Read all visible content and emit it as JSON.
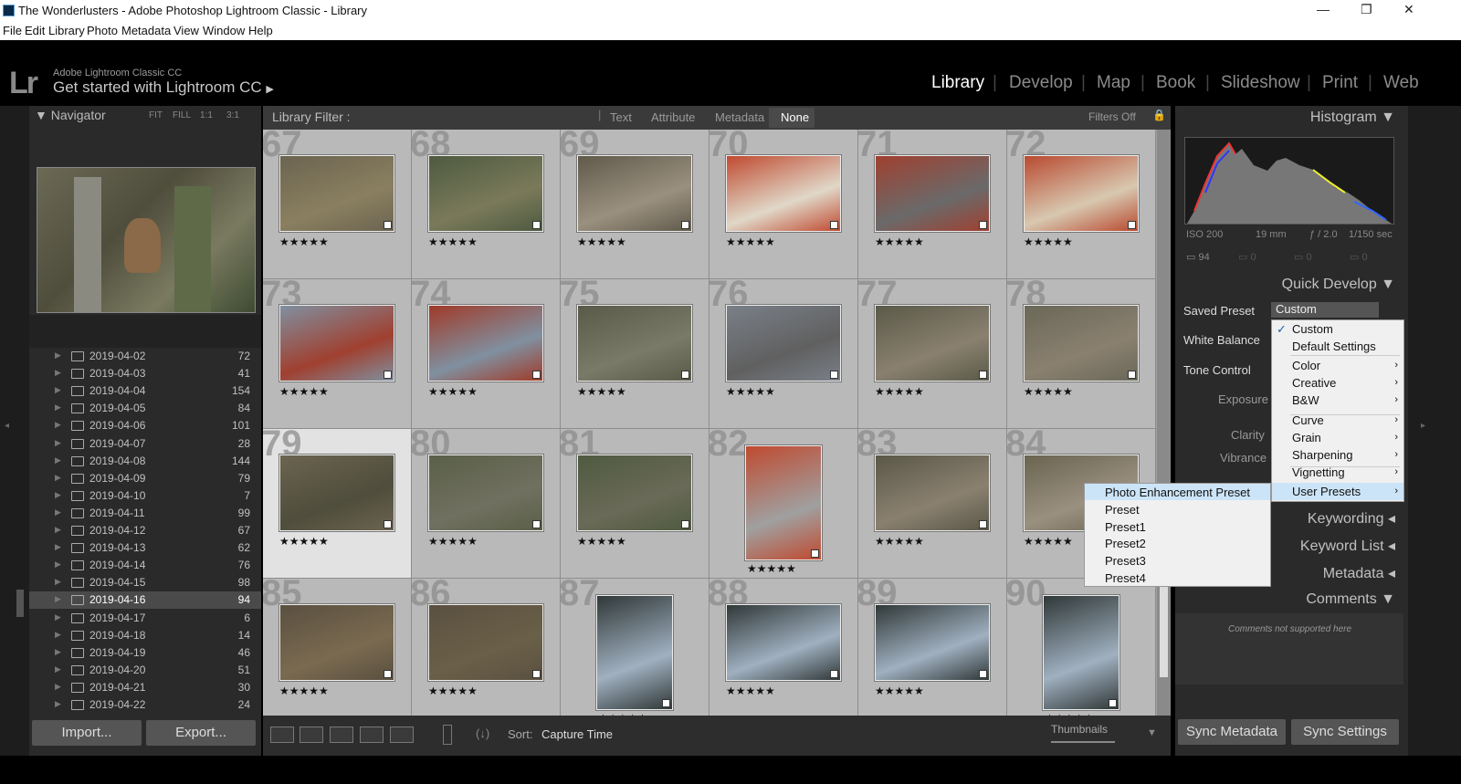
{
  "window": {
    "title": "The Wonderlusters - Adobe Photoshop Lightroom Classic - Library"
  },
  "menu": [
    "File",
    "Edit",
    "Library",
    "Photo",
    "Metadata",
    "View",
    "Window",
    "Help"
  ],
  "identity": {
    "line1": "Adobe Lightroom Classic CC",
    "line2": "Get started with Lightroom CC",
    "logo": "Lr"
  },
  "modules": [
    "Library",
    "Develop",
    "Map",
    "Book",
    "Slideshow",
    "Print",
    "Web"
  ],
  "navigator": {
    "title": "Navigator",
    "zooms": [
      "FIT",
      "FILL",
      "1:1",
      "3:1"
    ]
  },
  "folders": [
    {
      "name": "2019-04-02",
      "count": "72"
    },
    {
      "name": "2019-04-03",
      "count": "41"
    },
    {
      "name": "2019-04-04",
      "count": "154"
    },
    {
      "name": "2019-04-05",
      "count": "84"
    },
    {
      "name": "2019-04-06",
      "count": "101"
    },
    {
      "name": "2019-04-07",
      "count": "28"
    },
    {
      "name": "2019-04-08",
      "count": "144"
    },
    {
      "name": "2019-04-09",
      "count": "79"
    },
    {
      "name": "2019-04-10",
      "count": "7"
    },
    {
      "name": "2019-04-11",
      "count": "99"
    },
    {
      "name": "2019-04-12",
      "count": "67"
    },
    {
      "name": "2019-04-13",
      "count": "62"
    },
    {
      "name": "2019-04-14",
      "count": "76"
    },
    {
      "name": "2019-04-15",
      "count": "98"
    },
    {
      "name": "2019-04-16",
      "count": "94",
      "selected": true
    },
    {
      "name": "2019-04-17",
      "count": "6"
    },
    {
      "name": "2019-04-18",
      "count": "14"
    },
    {
      "name": "2019-04-19",
      "count": "46"
    },
    {
      "name": "2019-04-20",
      "count": "51"
    },
    {
      "name": "2019-04-21",
      "count": "30"
    },
    {
      "name": "2019-04-22",
      "count": "24"
    }
  ],
  "left_buttons": {
    "import": "Import...",
    "export": "Export..."
  },
  "filter": {
    "title": "Library Filter :",
    "tabs": [
      "Text",
      "Attribute",
      "Metadata",
      "None"
    ],
    "status": "Filters Off"
  },
  "grid": {
    "cells": [
      {
        "num": "67"
      },
      {
        "num": "68"
      },
      {
        "num": "69"
      },
      {
        "num": "70"
      },
      {
        "num": "71"
      },
      {
        "num": "72"
      },
      {
        "num": "73"
      },
      {
        "num": "74"
      },
      {
        "num": "75"
      },
      {
        "num": "76"
      },
      {
        "num": "77"
      },
      {
        "num": "78"
      },
      {
        "num": "79",
        "selected": true
      },
      {
        "num": "80"
      },
      {
        "num": "81"
      },
      {
        "num": "82",
        "portrait": true
      },
      {
        "num": "83"
      },
      {
        "num": "84"
      },
      {
        "num": "85"
      },
      {
        "num": "86"
      },
      {
        "num": "87",
        "portrait": true
      },
      {
        "num": "88"
      },
      {
        "num": "89"
      },
      {
        "num": "90",
        "portrait": true
      }
    ],
    "stars": "★★★★★"
  },
  "toolbar": {
    "sort_label": "Sort:",
    "sort_value": "Capture Time",
    "thumbs_label": "Thumbnails"
  },
  "histogram": {
    "title": "Histogram",
    "iso": "ISO 200",
    "focal": "19 mm",
    "aperture": "ƒ / 2.0",
    "shutter": "1/150 sec",
    "count": "94",
    "zeros": [
      "0",
      "0",
      "0"
    ]
  },
  "quick_develop": {
    "title": "Quick Develop",
    "saved_preset_label": "Saved Preset",
    "saved_preset_value": "Custom",
    "white_balance": "White Balance",
    "tone_control": "Tone Control",
    "exposure": "Exposure",
    "clarity": "Clarity",
    "vibrance": "Vibrance"
  },
  "preset_menu": [
    {
      "label": "Custom",
      "checked": true
    },
    {
      "label": "Default Settings"
    },
    {
      "label": "Color",
      "sub": true
    },
    {
      "label": "Creative",
      "sub": true
    },
    {
      "label": "B&W",
      "sub": true
    },
    {
      "label": "Curve",
      "sub": true
    },
    {
      "label": "Grain",
      "sub": true
    },
    {
      "label": "Sharpening",
      "sub": true
    },
    {
      "label": "Vignetting",
      "sub": true
    },
    {
      "label": "User Presets",
      "sub": true,
      "highlight": true
    }
  ],
  "user_presets_menu": [
    "Photo Enhancement Preset",
    "Preset",
    "Preset1",
    "Preset2",
    "Preset3",
    "Preset4"
  ],
  "right_sections": {
    "keywording": "Keywording",
    "keyword_list": "Keyword List",
    "metadata": "Metadata",
    "comments": "Comments",
    "comments_note": "Comments not supported here"
  },
  "right_buttons": {
    "sync_metadata": "Sync Metadata",
    "sync_settings": "Sync Settings"
  },
  "colors": {
    "accent_highlight": "#cce4f7",
    "grid_bg": "#9f9f9f",
    "panel_bg": "#2a2a2a"
  }
}
